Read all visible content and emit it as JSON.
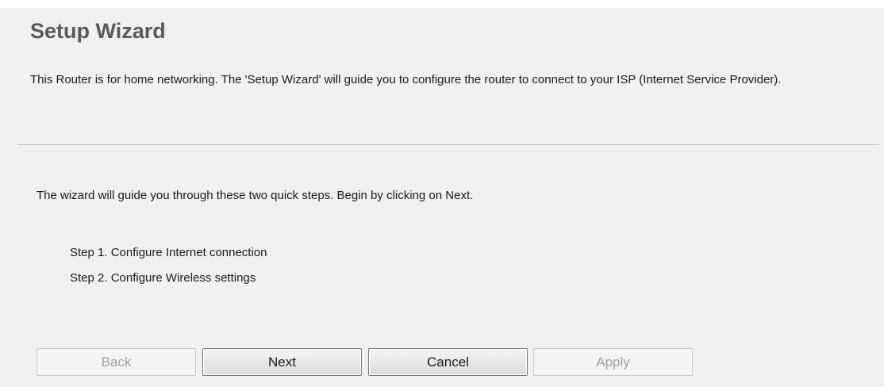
{
  "header": {
    "title": "Setup Wizard",
    "intro": "This Router is for home networking. The 'Setup Wizard' will guide you to configure the router to connect to your ISP (Internet Service Provider)."
  },
  "content": {
    "guide_text": "The wizard will guide you through these two quick steps. Begin by clicking on Next.",
    "steps": [
      "Step 1. Configure Internet connection",
      "Step 2. Configure Wireless settings"
    ]
  },
  "buttons": {
    "back": {
      "label": "Back",
      "enabled": false
    },
    "next": {
      "label": "Next",
      "enabled": true
    },
    "cancel": {
      "label": "Cancel",
      "enabled": true
    },
    "apply": {
      "label": "Apply",
      "enabled": false
    }
  },
  "colors": {
    "background": "#f0f0f0",
    "title": "#5a5a5a",
    "text": "#1a1a1a",
    "disabled_text": "#9e9e9e",
    "divider": "#b9b9b9"
  }
}
